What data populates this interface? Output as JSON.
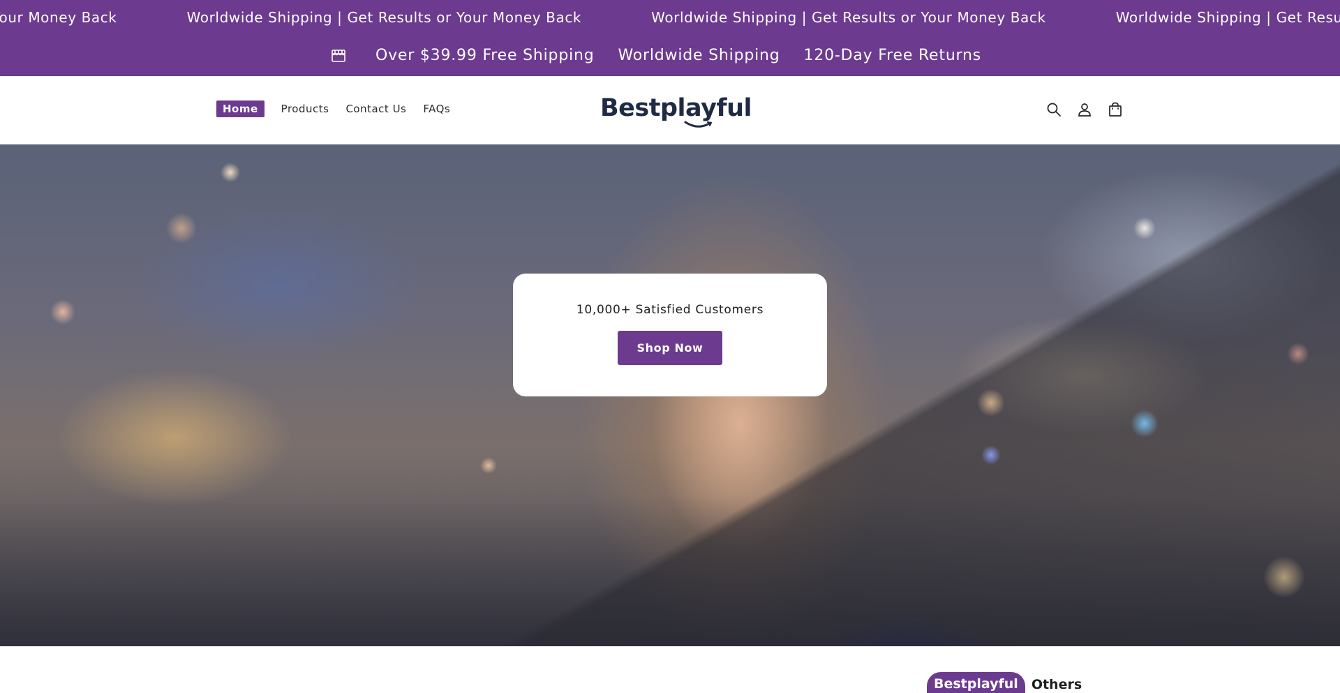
{
  "announcement": {
    "items": [
      "Worldwide Shipping | Get Results or Your Money Back",
      "Worldwide Shipping | Get Results or Your Money Back",
      "Worldwide Shipping | Get Results or Your Money Back",
      "Worldwide Shipping | Get Results or Your Money Back"
    ]
  },
  "benefits": {
    "icon": "store-icon",
    "items": [
      "Over $39.99 Free Shipping",
      "Worldwide Shipping",
      "120-Day Free Returns"
    ]
  },
  "header": {
    "nav": [
      {
        "label": "Home",
        "active": true
      },
      {
        "label": "Products",
        "active": false
      },
      {
        "label": "Contact Us",
        "active": false
      },
      {
        "label": "FAQs",
        "active": false
      }
    ],
    "logo_text": "Bestplayful",
    "icons": [
      "search-icon",
      "account-icon",
      "cart-icon"
    ]
  },
  "hero": {
    "subtitle": "10,000+ Satisfied Customers",
    "button_label": "Shop Now"
  },
  "tabs": [
    {
      "label": "Bestplayful",
      "active": true
    },
    {
      "label": "Others",
      "active": false
    }
  ],
  "colors": {
    "brand": "#6c3a8f",
    "logo": "#1f2a44",
    "text": "#2a2a2a"
  }
}
